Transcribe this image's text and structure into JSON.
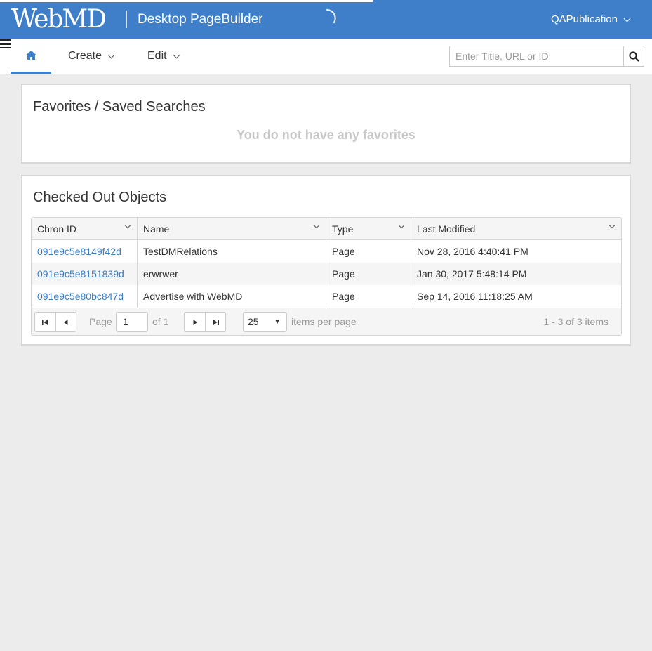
{
  "header": {
    "logo_text": "WebMD",
    "app_title": "Desktop PageBuilder",
    "user": "QAPublication"
  },
  "nav": {
    "home_icon": "home-icon",
    "items": [
      {
        "label": "Create"
      },
      {
        "label": "Edit"
      }
    ],
    "menu_icon": "hamburger-icon",
    "search": {
      "placeholder": "Enter Title, URL or ID",
      "value": "",
      "icon": "search-icon"
    }
  },
  "favorites": {
    "title": "Favorites / Saved Searches",
    "empty_message": "You do not have any favorites"
  },
  "checked_out": {
    "title": "Checked Out Objects",
    "columns": [
      "Chron ID",
      "Name",
      "Type",
      "Last Modified"
    ],
    "rows": [
      {
        "chron_id": "091e9c5e8149f42d",
        "name": "TestDMRelations",
        "type": "Page",
        "last_modified": "Nov 28, 2016 4:40:41 PM"
      },
      {
        "chron_id": "091e9c5e8151839d",
        "name": "erwrwer",
        "type": "Page",
        "last_modified": "Jan 30, 2017 5:48:14 PM"
      },
      {
        "chron_id": "091e9c5e80bc847d",
        "name": "Advertise with WebMD",
        "type": "Page",
        "last_modified": "Sep 14, 2016 11:18:25 AM"
      }
    ],
    "pager": {
      "page_label": "Page",
      "page_value": "1",
      "of_label": "of 1",
      "page_size": "25",
      "items_per_page_label": "items per page",
      "info": "1 - 3 of 3 items"
    }
  },
  "colors": {
    "header_bg": "#3f7fca",
    "link": "#3a7bc8",
    "page_bg": "#ececec"
  }
}
